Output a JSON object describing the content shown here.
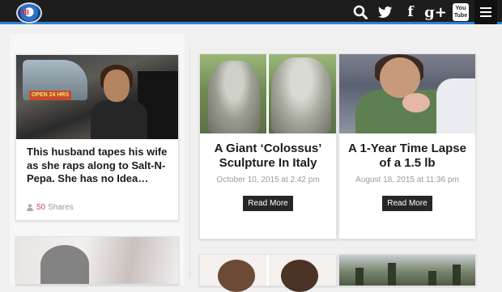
{
  "header": {
    "logo_text": "FB",
    "icons": [
      "search-icon",
      "twitter-icon",
      "facebook-icon",
      "google-plus-icon",
      "youtube-icon",
      "menu-icon"
    ],
    "gplus_label": "g+",
    "youtube_label": "You\nTube",
    "accent_color": "#2a7fd4"
  },
  "left_column": {
    "card1": {
      "image_sign": "OPEN 24 HRS",
      "title": "This husband tapes his wife as she raps along to Salt-N-Pepa. She has no Idea…",
      "share_count": "50",
      "share_label": "Shares"
    }
  },
  "grid": {
    "cards": [
      {
        "title": "A Giant ‘Colossus’ Sculpture In Italy",
        "date": "October 10, 2015 at 2:42 pm",
        "button": "Read More"
      },
      {
        "title": "A 1-Year Time Lapse of a 1.5 lb",
        "date": "August 18, 2015 at 11:36 pm",
        "button": "Read More"
      }
    ]
  }
}
